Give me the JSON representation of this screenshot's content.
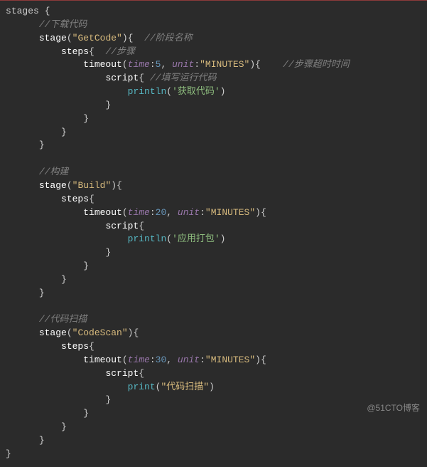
{
  "watermark": "@51CTO博客",
  "code": {
    "stages_open": "stages {",
    "s1": {
      "comment": "//下载代码",
      "stage_fn": "stage",
      "stage_arg": "\"GetCode\"",
      "stage_inline_cmt": "//阶段名称",
      "steps": "steps",
      "steps_inline_cmt": "//步骤",
      "timeout_fn": "timeout",
      "timeout_time_key": "time",
      "timeout_time_val": "5",
      "timeout_unit_key": "unit",
      "timeout_unit_val": "\"MINUTES\"",
      "timeout_inline_cmt": "//步骤超时时间",
      "script": "script",
      "script_inline_cmt": "//填写运行代码",
      "println": "println",
      "println_arg": "'获取代码'"
    },
    "s2": {
      "comment": "//构建",
      "stage_fn": "stage",
      "stage_arg": "\"Build\"",
      "steps": "steps",
      "timeout_fn": "timeout",
      "timeout_time_key": "time",
      "timeout_time_val": "20",
      "timeout_unit_key": "unit",
      "timeout_unit_val": "\"MINUTES\"",
      "script": "script",
      "println": "println",
      "println_arg": "'应用打包'"
    },
    "s3": {
      "comment": "//代码扫描",
      "stage_fn": "stage",
      "stage_arg": "\"CodeScan\"",
      "steps": "steps",
      "timeout_fn": "timeout",
      "timeout_time_key": "time",
      "timeout_time_val": "30",
      "timeout_unit_key": "unit",
      "timeout_unit_val": "\"MINUTES\"",
      "script": "script",
      "print": "print",
      "print_arg": "\"代码扫描\""
    }
  }
}
